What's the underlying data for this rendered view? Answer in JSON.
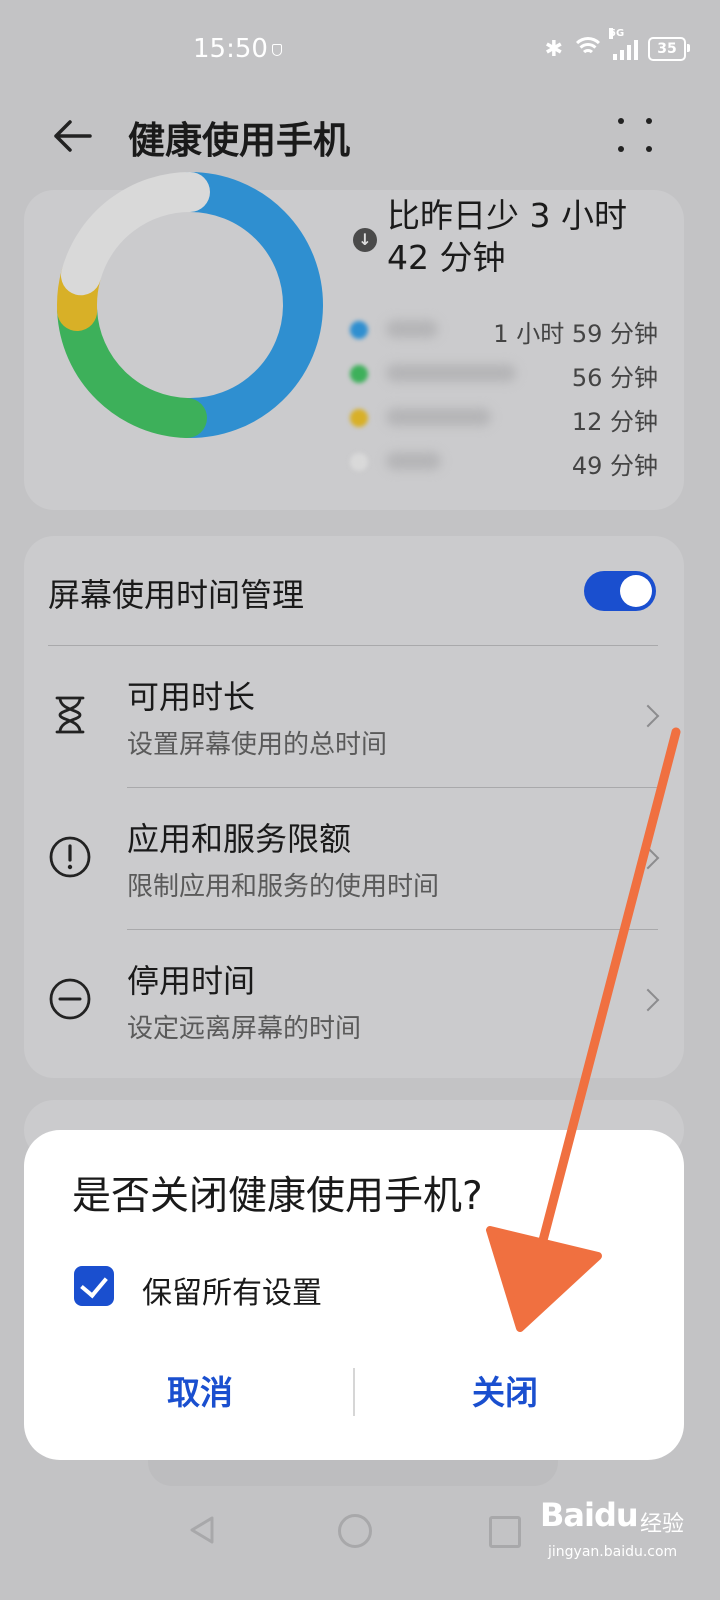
{
  "status_bar": {
    "time": "15:50",
    "network": "5G",
    "battery": "35"
  },
  "header": {
    "title": "健康使用手机"
  },
  "usage_summary": {
    "delta_text": "比昨日少 3 小时 42 分钟",
    "chart_data": {
      "type": "pie",
      "categories": [
        "",
        "",
        "",
        ""
      ],
      "values": [
        119,
        56,
        12,
        49
      ],
      "colors": [
        "#2f8fd0",
        "#3db05a",
        "#d8b027",
        "#d9d9d9"
      ]
    },
    "legend": [
      {
        "value": "1 小时 59 分钟",
        "color": "#2f8fd0"
      },
      {
        "value": "56 分钟",
        "color": "#3db05a"
      },
      {
        "value": "12 分钟",
        "color": "#d8b027"
      },
      {
        "value": "49 分钟",
        "color": "#d9d9d9"
      }
    ]
  },
  "screen_time": {
    "toggle_label": "屏幕使用时间管理",
    "toggle_on": true,
    "items": [
      {
        "title": "可用时长",
        "subtitle": "设置屏幕使用的总时间",
        "icon": "hourglass-icon"
      },
      {
        "title": "应用和服务限额",
        "subtitle": "限制应用和服务的使用时间",
        "icon": "exclamation-circle-icon"
      },
      {
        "title": "停用时间",
        "subtitle": "设定远离屏幕的时间",
        "icon": "minus-circle-icon"
      }
    ]
  },
  "dialog": {
    "title": "是否关闭健康使用手机?",
    "checkbox_label": "保留所有设置",
    "checkbox_checked": true,
    "cancel_label": "取消",
    "confirm_label": "关闭"
  },
  "watermark": {
    "logo": "Baidu",
    "text": "经验",
    "url": "jingyan.baidu.com"
  },
  "colors": {
    "accent": "#1a4fcf",
    "arrow": "#f07040",
    "background": "#c3c3c5"
  }
}
